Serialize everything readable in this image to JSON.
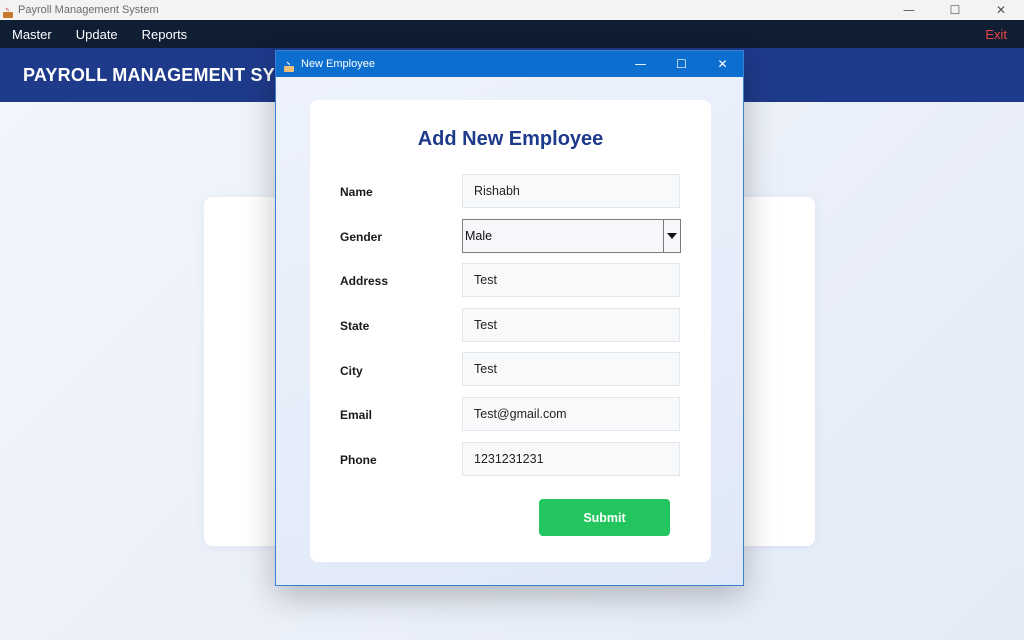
{
  "window": {
    "title": "Payroll Management System",
    "controls": {
      "minimize": "—",
      "maximize": "☐",
      "close": "✕"
    }
  },
  "menubar": {
    "items": [
      "Master",
      "Update",
      "Reports"
    ],
    "exit_label": "Exit"
  },
  "banner": {
    "title": "PAYROLL MANAGEMENT SYSTEM"
  },
  "dialog": {
    "title": "New Employee",
    "controls": {
      "minimize": "—",
      "maximize": "☐",
      "close": "✕"
    },
    "heading": "Add New Employee",
    "fields": {
      "name": {
        "label": "Name",
        "value": "Rishabh"
      },
      "gender": {
        "label": "Gender",
        "value": "Male"
      },
      "address": {
        "label": "Address",
        "value": "Test"
      },
      "state": {
        "label": "State",
        "value": "Test"
      },
      "city": {
        "label": "City",
        "value": "Test"
      },
      "email": {
        "label": "Email",
        "value": "Test@gmail.com"
      },
      "phone": {
        "label": "Phone",
        "value": "1231231231"
      }
    },
    "submit_label": "Submit"
  },
  "colors": {
    "menubar_bg": "#0f1e33",
    "banner_bg": "#1e3a8a",
    "dialog_titlebar": "#0c6fd0",
    "heading": "#1e3a8a",
    "submit": "#22c55e",
    "exit": "#ef4444"
  }
}
